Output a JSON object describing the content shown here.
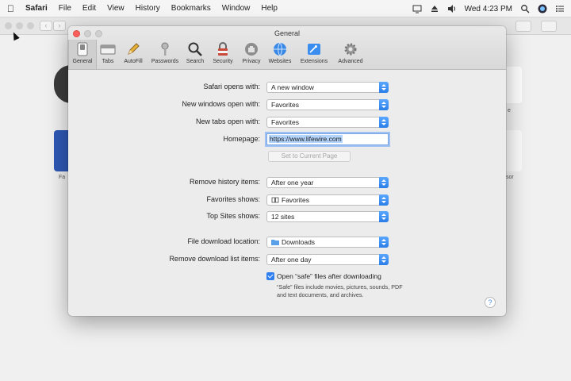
{
  "menubar": {
    "app": "Safari",
    "items": [
      "File",
      "Edit",
      "View",
      "History",
      "Bookmarks",
      "Window",
      "Help"
    ],
    "clock": "Wed 4:23 PM"
  },
  "prefs": {
    "title": "General",
    "tabs": [
      {
        "label": "General",
        "icon": "switch-icon"
      },
      {
        "label": "Tabs",
        "icon": "tabs-icon"
      },
      {
        "label": "AutoFill",
        "icon": "pencil-icon"
      },
      {
        "label": "Passwords",
        "icon": "key-icon"
      },
      {
        "label": "Search",
        "icon": "magnifier-icon"
      },
      {
        "label": "Security",
        "icon": "lock-icon"
      },
      {
        "label": "Privacy",
        "icon": "hand-icon"
      },
      {
        "label": "Websites",
        "icon": "globe-icon"
      },
      {
        "label": "Extensions",
        "icon": "puzzle-icon"
      },
      {
        "label": "Advanced",
        "icon": "gear-icon"
      }
    ],
    "safari_opens_with": {
      "label": "Safari opens with:",
      "value": "A new window"
    },
    "new_windows": {
      "label": "New windows open with:",
      "value": "Favorites"
    },
    "new_tabs": {
      "label": "New tabs open with:",
      "value": "Favorites"
    },
    "homepage": {
      "label": "Homepage:",
      "value": "https://www.lifewire.com"
    },
    "set_current": "Set to Current Page",
    "remove_history": {
      "label": "Remove history items:",
      "value": "After one year"
    },
    "favorites_shows": {
      "label": "Favorites shows:",
      "value": "Favorites"
    },
    "top_sites": {
      "label": "Top Sites shows:",
      "value": "12 sites"
    },
    "download_location": {
      "label": "File download location:",
      "value": "Downloads"
    },
    "remove_download": {
      "label": "Remove download list items:",
      "value": "After one day"
    },
    "open_safe": {
      "label": "Open “safe” files after downloading",
      "checked": true
    },
    "open_safe_note": "“Safe” files include movies, pictures, sounds, PDF and text documents, and archives.",
    "help": "?"
  },
  "background": {
    "labels": [
      "Fa",
      "e",
      "sor"
    ]
  },
  "colors": {
    "accent": "#2f7ff0",
    "close": "#fc605c"
  }
}
